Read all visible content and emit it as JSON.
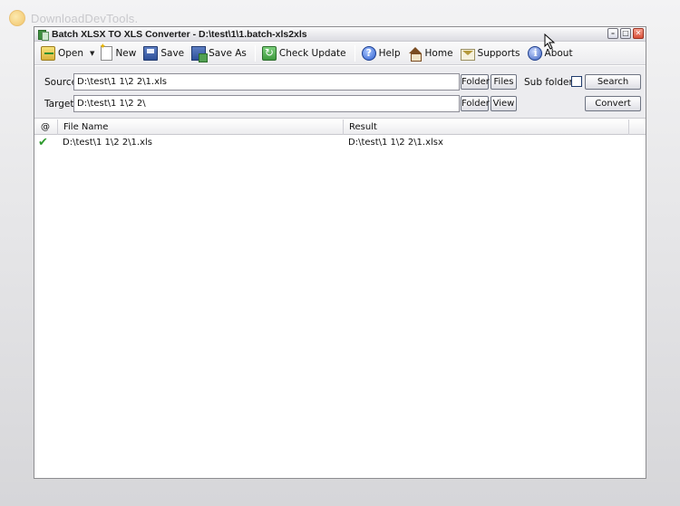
{
  "watermark": {
    "text": "DownloadDevTools."
  },
  "window": {
    "title": "Batch XLSX TO XLS Converter - D:\\test\\1\\1.batch-xls2xls",
    "controls": [
      "minimize",
      "maximize",
      "close"
    ]
  },
  "toolbar": {
    "items": [
      {
        "id": "open",
        "label": "Open",
        "icon": "open-folder-icon"
      },
      {
        "id": "new",
        "label": "New",
        "icon": "new-document-icon"
      },
      {
        "id": "save",
        "label": "Save",
        "icon": "save-icon"
      },
      {
        "id": "saveas",
        "label": "Save As",
        "icon": "save-as-icon"
      },
      {
        "id": "update",
        "label": "Check Update",
        "icon": "update-icon"
      },
      {
        "id": "help",
        "label": "Help",
        "icon": "help-icon"
      },
      {
        "id": "home",
        "label": "Home",
        "icon": "home-icon"
      },
      {
        "id": "supports",
        "label": "Supports",
        "icon": "mail-icon"
      },
      {
        "id": "about",
        "label": "About",
        "icon": "info-icon"
      }
    ]
  },
  "form": {
    "source_label": "Source",
    "source_value": "D:\\test\\1 1\\2 2\\1.xls",
    "target_label": "Target",
    "target_value": "D:\\test\\1 1\\2 2\\",
    "folder_label": "Folder",
    "files_label": "Files",
    "view_label": "View",
    "subfolders_label": "Sub folders",
    "subfolders_checked": false,
    "search_label": "Search",
    "convert_label": "Convert"
  },
  "list": {
    "columns": [
      "@",
      "File Name",
      "Result"
    ],
    "rows": [
      {
        "status": "success",
        "file": "D:\\test\\1 1\\2 2\\1.xls",
        "result": "D:\\test\\1 1\\2 2\\1.xlsx"
      }
    ]
  }
}
